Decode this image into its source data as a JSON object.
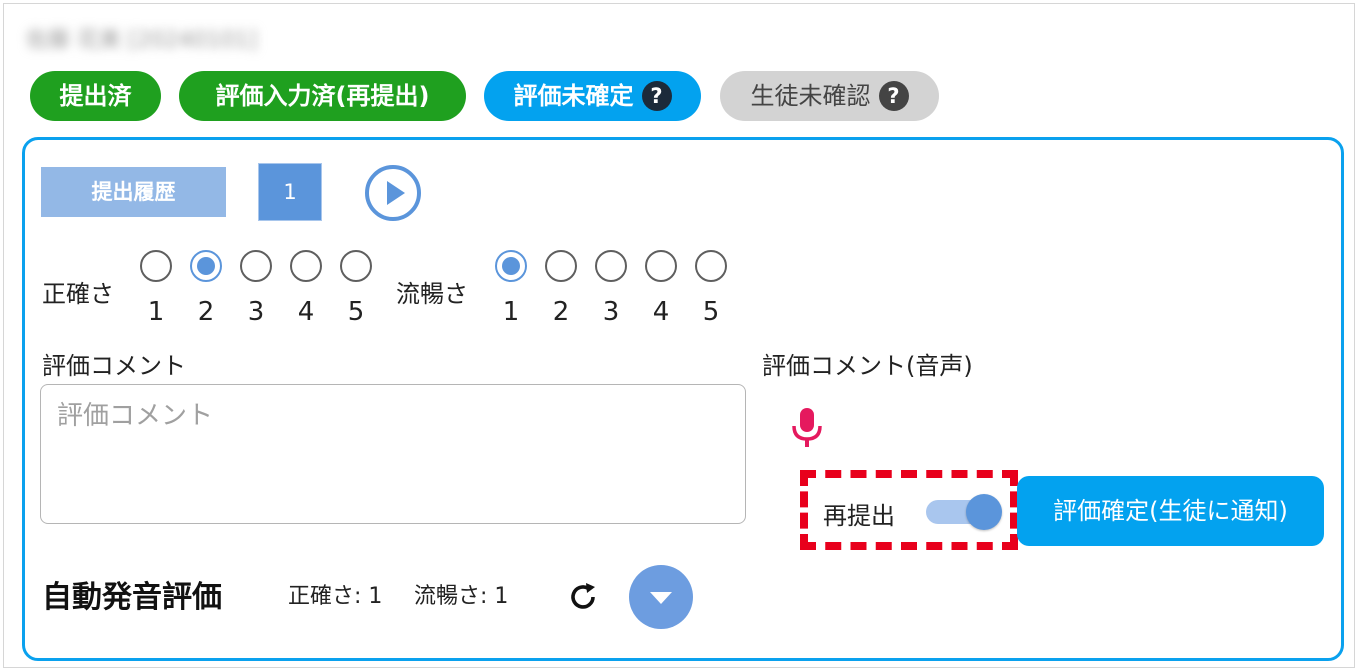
{
  "header": {
    "student_name": "佐藤 花美 [20240101]"
  },
  "status_pills": [
    {
      "label": "提出済",
      "style": "green"
    },
    {
      "label": "評価入力済(再提出)",
      "style": "green"
    },
    {
      "label": "評価未確定",
      "style": "blue",
      "icon": "question-icon"
    },
    {
      "label": "生徒未確認",
      "style": "gray",
      "icon": "question-icon"
    }
  ],
  "history": {
    "button_label": "提出履歴",
    "page_number": "1",
    "next_icon": "play-circle-icon"
  },
  "ratings": {
    "accuracy": {
      "label": "正確さ",
      "options": [
        "1",
        "2",
        "3",
        "4",
        "5"
      ],
      "selected": "2"
    },
    "fluency": {
      "label": "流暢さ",
      "options": [
        "1",
        "2",
        "3",
        "4",
        "5"
      ],
      "selected": "1"
    }
  },
  "comment": {
    "label": "評価コメント",
    "placeholder": "評価コメント",
    "value": ""
  },
  "voice_comment": {
    "label": "評価コメント(音声)",
    "icon": "microphone-icon"
  },
  "resubmit": {
    "label": "再提出",
    "toggle_on": true
  },
  "confirm_button": {
    "label": "評価確定(生徒に通知)"
  },
  "auto_eval": {
    "title": "自動発音評価",
    "accuracy_text": "正確さ: 1",
    "fluency_text": "流暢さ: 1",
    "refresh_icon": "refresh-icon",
    "expand_icon": "chevron-down-circle-icon"
  },
  "colors": {
    "green": "#1fa01f",
    "blue": "#03a2ef",
    "gray": "#d3d3d3",
    "accent": "#5b95db",
    "mic": "#e5195e",
    "highlight": "#e8001c"
  }
}
